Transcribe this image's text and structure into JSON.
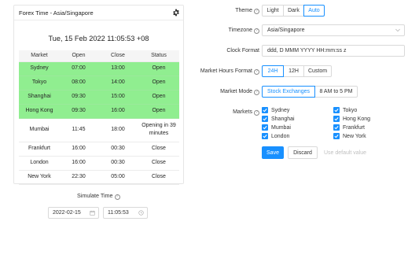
{
  "widget": {
    "title": "Forex Time - Asia/Singapore",
    "settings_icon": "gear-icon",
    "clock_text": "Tue, 15 Feb 2022 11:05:53 +08",
    "table": {
      "headers": [
        "Market",
        "Open",
        "Close",
        "Status"
      ],
      "rows": [
        {
          "market": "Sydney",
          "open": "07:00",
          "close": "13:00",
          "status": "Open",
          "is_open": true
        },
        {
          "market": "Tokyo",
          "open": "08:00",
          "close": "14:00",
          "status": "Open",
          "is_open": true
        },
        {
          "market": "Shanghai",
          "open": "09:30",
          "close": "15:00",
          "status": "Open",
          "is_open": true
        },
        {
          "market": "Hong Kong",
          "open": "09:30",
          "close": "16:00",
          "status": "Open",
          "is_open": true
        },
        {
          "market": "Mumbai",
          "open": "11:45",
          "close": "18:00",
          "status": "Opening in 39 minutes",
          "is_open": false
        },
        {
          "market": "Frankfurt",
          "open": "16:00",
          "close": "00:30",
          "status": "Close",
          "is_open": false
        },
        {
          "market": "London",
          "open": "16:00",
          "close": "00:30",
          "status": "Close",
          "is_open": false
        },
        {
          "market": "New York",
          "open": "22:30",
          "close": "05:00",
          "status": "Close",
          "is_open": false
        }
      ],
      "open_row_color": "#90ee90"
    },
    "simulate": {
      "label": "Simulate Time",
      "date_value": "2022-02-15",
      "time_value": "11:05:53",
      "date_icon": "calendar-icon",
      "time_icon": "clock-icon"
    }
  },
  "settings": {
    "theme": {
      "label": "Theme",
      "options": [
        "Light",
        "Dark",
        "Auto"
      ],
      "selected": "Auto"
    },
    "timezone": {
      "label": "Timezone",
      "value": "Asia/Singapore"
    },
    "clock_format": {
      "label": "Clock Format",
      "value": "ddd, D MMM YYYY HH:mm:ss z"
    },
    "market_hours_format": {
      "label": "Market Hours Format",
      "options": [
        "24H",
        "12H",
        "Custom"
      ],
      "selected": "24H"
    },
    "market_mode": {
      "label": "Market Mode",
      "options": [
        "Stock Exchanges",
        "8 AM to 5 PM"
      ],
      "selected": "Stock Exchanges"
    },
    "markets": {
      "label": "Markets",
      "items": [
        {
          "name": "Sydney",
          "checked": true
        },
        {
          "name": "Tokyo",
          "checked": true
        },
        {
          "name": "Shanghai",
          "checked": true
        },
        {
          "name": "Hong Kong",
          "checked": true
        },
        {
          "name": "Mumbai",
          "checked": true
        },
        {
          "name": "Frankfurt",
          "checked": true
        },
        {
          "name": "London",
          "checked": true
        },
        {
          "name": "New York",
          "checked": true
        }
      ]
    },
    "actions": {
      "save": "Save",
      "discard": "Discard",
      "default": "Use default value"
    }
  },
  "colors": {
    "accent": "#1890ff",
    "open": "#90ee90"
  }
}
